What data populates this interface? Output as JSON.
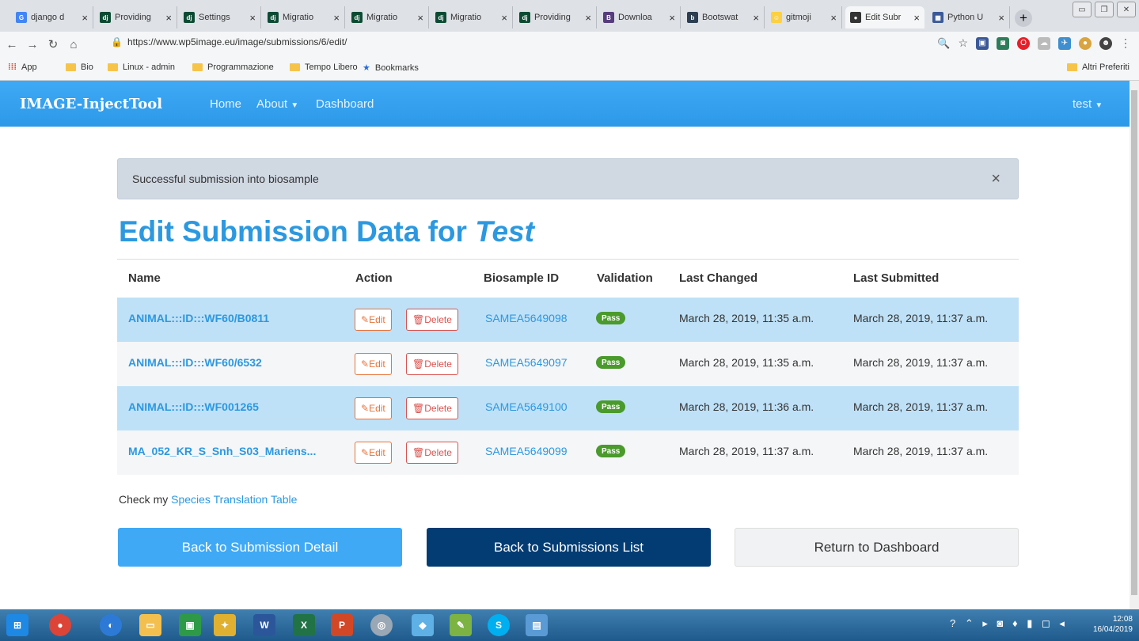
{
  "browser": {
    "tabs": [
      {
        "label": "django d",
        "icon": "google-icon",
        "color": "#4285f4",
        "glyph": "G"
      },
      {
        "label": "Providing",
        "icon": "django-icon",
        "color": "#0c4b33",
        "glyph": "dj"
      },
      {
        "label": "Settings",
        "icon": "django-icon",
        "color": "#0c4b33",
        "glyph": "dj"
      },
      {
        "label": "Migratio",
        "icon": "django-icon",
        "color": "#0c4b33",
        "glyph": "dj"
      },
      {
        "label": "Migratio",
        "icon": "django-icon",
        "color": "#0c4b33",
        "glyph": "dj"
      },
      {
        "label": "Migratio",
        "icon": "django-icon",
        "color": "#0c4b33",
        "glyph": "dj"
      },
      {
        "label": "Providing",
        "icon": "django-icon",
        "color": "#0c4b33",
        "glyph": "dj"
      },
      {
        "label": "Downloa",
        "icon": "bootstrap-icon",
        "color": "#563d7c",
        "glyph": "B"
      },
      {
        "label": "Bootswat",
        "icon": "bootswatch-icon",
        "color": "#2c3e50",
        "glyph": "b"
      },
      {
        "label": "gitmoji",
        "icon": "gitmoji-icon",
        "color": "#fbd043",
        "glyph": "☺"
      },
      {
        "label": "Edit Subr",
        "icon": "site-icon",
        "color": "#333333",
        "glyph": "●"
      },
      {
        "label": "Python U",
        "icon": "doc-icon",
        "color": "#3b5998",
        "glyph": "▦"
      }
    ],
    "new_tab": "+",
    "url": "https://www.wp5image.eu/image/submissions/6/edit/",
    "bookmarks": [
      "App",
      "Bio",
      "Linux - admin",
      "Programmazione",
      "Tempo Libero",
      "Bookmarks"
    ],
    "other_bookmarks": "Altri Preferiti"
  },
  "navbar": {
    "brand": "IMAGE-InjectTool",
    "links": [
      "Home",
      "About",
      "Dashboard"
    ],
    "user": "test"
  },
  "alert": {
    "text": "Successful submission into biosample",
    "close": "×"
  },
  "page": {
    "title_prefix": "Edit Submission Data for ",
    "title_name": "Test"
  },
  "table": {
    "headers": [
      "Name",
      "Action",
      "Biosample ID",
      "Validation",
      "Last Changed",
      "Last Submitted"
    ],
    "edit_label": "Edit",
    "delete_label": "Delete",
    "rows": [
      {
        "name": "ANIMAL:::ID:::WF60/B0811",
        "biosample_id": "SAMEA5649098",
        "validation": "Pass",
        "last_changed": "March 28, 2019, 11:35 a.m.",
        "last_submitted": "March 28, 2019, 11:37 a.m."
      },
      {
        "name": "ANIMAL:::ID:::WF60/6532",
        "biosample_id": "SAMEA5649097",
        "validation": "Pass",
        "last_changed": "March 28, 2019, 11:35 a.m.",
        "last_submitted": "March 28, 2019, 11:37 a.m."
      },
      {
        "name": "ANIMAL:::ID:::WF001265",
        "biosample_id": "SAMEA5649100",
        "validation": "Pass",
        "last_changed": "March 28, 2019, 11:36 a.m.",
        "last_submitted": "March 28, 2019, 11:37 a.m."
      },
      {
        "name": "MA_052_KR_S_Snh_S03_Mariens...",
        "biosample_id": "SAMEA5649099",
        "validation": "Pass",
        "last_changed": "March 28, 2019, 11:37 a.m.",
        "last_submitted": "March 28, 2019, 11:37 a.m."
      }
    ]
  },
  "check": {
    "prefix": "Check my ",
    "link": "Species Translation Table"
  },
  "buttons": {
    "back_detail": "Back to Submission Detail",
    "back_list": "Back to Submissions List",
    "dashboard": "Return to Dashboard"
  },
  "taskbar": {
    "time": "12:08",
    "date": "16/04/2019"
  },
  "colors": {
    "primary": "#3fa9f5",
    "link": "#2c98df",
    "dark": "#033c73",
    "pass": "#4a9a2c"
  }
}
